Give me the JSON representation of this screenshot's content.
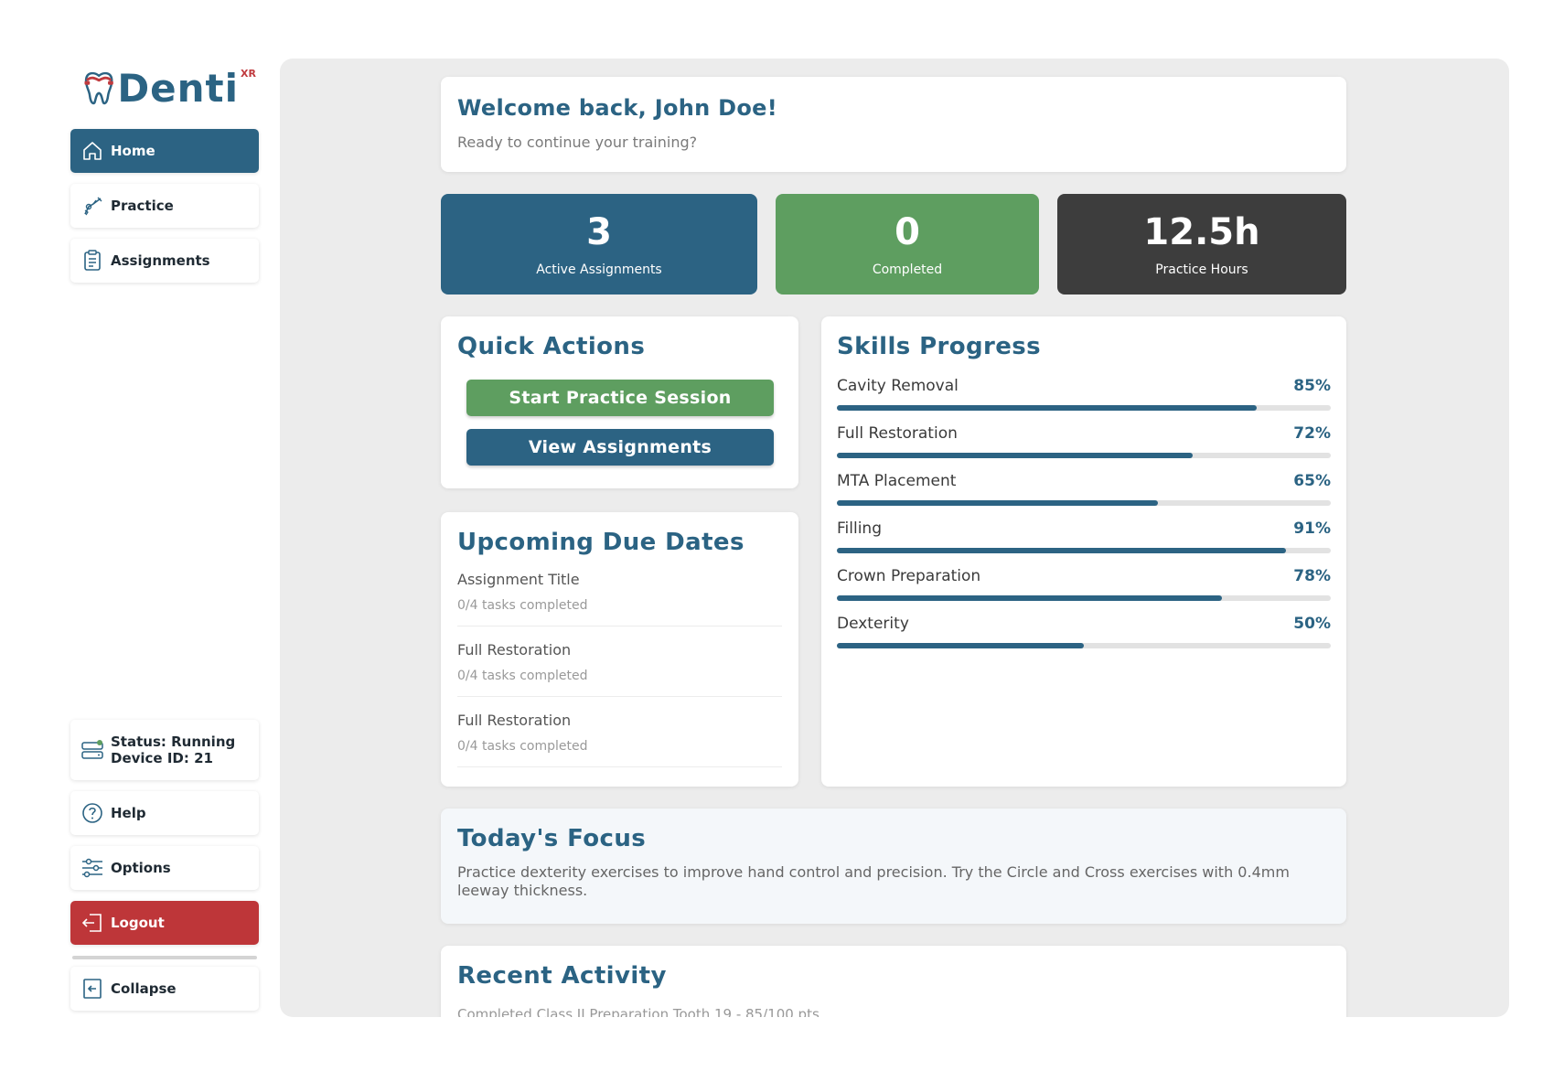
{
  "brand": {
    "name": "Denti",
    "superscript": "XR"
  },
  "sidebar": {
    "nav": [
      {
        "label": "Home",
        "icon": "home-icon"
      },
      {
        "label": "Practice",
        "icon": "dental-drill-icon"
      },
      {
        "label": "Assignments",
        "icon": "clipboard-icon"
      }
    ],
    "status_line": "Status: Running",
    "device_line": "Device ID: 21",
    "help": "Help",
    "options": "Options",
    "logout": "Logout",
    "collapse": "Collapse"
  },
  "welcome": {
    "title": "Welcome back, John Doe!",
    "subtitle": "Ready to continue your training?"
  },
  "stats": [
    {
      "value": "3",
      "label": "Active Assignments",
      "color": "#2c6383"
    },
    {
      "value": "0",
      "label": "Completed",
      "color": "#5e9e60"
    },
    {
      "value": "12.5h",
      "label": "Practice Hours",
      "color": "#3d3d3d"
    }
  ],
  "quick_actions": {
    "title": "Quick Actions",
    "start_label": "Start Practice Session",
    "view_label": "View Assignments"
  },
  "due_dates": {
    "title": "Upcoming Due Dates",
    "items": [
      {
        "title": "Assignment Title",
        "progress": "0/4 tasks completed"
      },
      {
        "title": "Full Restoration",
        "progress": "0/4 tasks completed"
      },
      {
        "title": "Full Restoration",
        "progress": "0/4 tasks completed"
      }
    ]
  },
  "skills": {
    "title": "Skills Progress",
    "items": [
      {
        "name": "Cavity Removal",
        "percent_label": "85%",
        "value": 0.85
      },
      {
        "name": "Full Restoration",
        "percent_label": "72%",
        "value": 0.72
      },
      {
        "name": "MTA Placement",
        "percent_label": "65%",
        "value": 0.65
      },
      {
        "name": "Filling",
        "percent_label": "91%",
        "value": 0.91
      },
      {
        "name": "Crown Preparation",
        "percent_label": "78%",
        "value": 0.78
      },
      {
        "name": "Dexterity",
        "percent_label": "50%",
        "value": 0.5
      }
    ]
  },
  "focus": {
    "title": "Today's Focus",
    "text": "Practice dexterity exercises to improve hand control and precision. Try the Circle and Cross exercises with 0.4mm leeway thickness."
  },
  "recent": {
    "title": "Recent Activity",
    "first_item": "Completed Class II Preparation Tooth 19 - 85/100 pts"
  },
  "colors": {
    "primary": "#2c6383",
    "success": "#5e9e60",
    "danger": "#be3639",
    "dark": "#3d3d3d"
  }
}
